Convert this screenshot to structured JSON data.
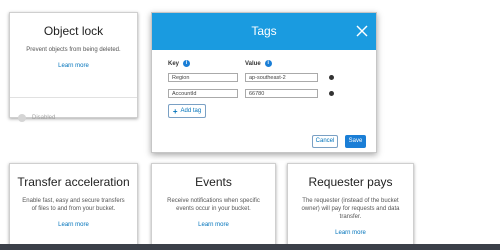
{
  "cards": {
    "object_lock": {
      "title": "Object lock",
      "description": "Prevent objects from being deleted.",
      "link": "Learn more",
      "status": "Disabled"
    },
    "transfer_acceleration": {
      "title": "Transfer acceleration",
      "description": "Enable fast, easy and secure transfers of files to and from your bucket.",
      "link": "Learn more"
    },
    "events": {
      "title": "Events",
      "description": "Receive notifications when specific events occur in your bucket.",
      "link": "Learn more"
    },
    "requester_pays": {
      "title": "Requester pays",
      "description": "The requester (instead of the bucket owner) will pay for requests and data transfer.",
      "link": "Learn more"
    }
  },
  "modal": {
    "title": "Tags",
    "close_icon": "close-icon",
    "key_header": "Key",
    "value_header": "Value",
    "info_glyph": "i",
    "tags": [
      {
        "key": "Region",
        "value": "ap-southeast-2"
      },
      {
        "key": "AccountId",
        "value": "66780"
      }
    ],
    "add_tag_label": "Add tag",
    "cancel_label": "Cancel",
    "save_label": "Save"
  },
  "colors": {
    "header_blue": "#1a9be0",
    "primary_button": "#1a7ed6",
    "link": "#0073bb"
  }
}
